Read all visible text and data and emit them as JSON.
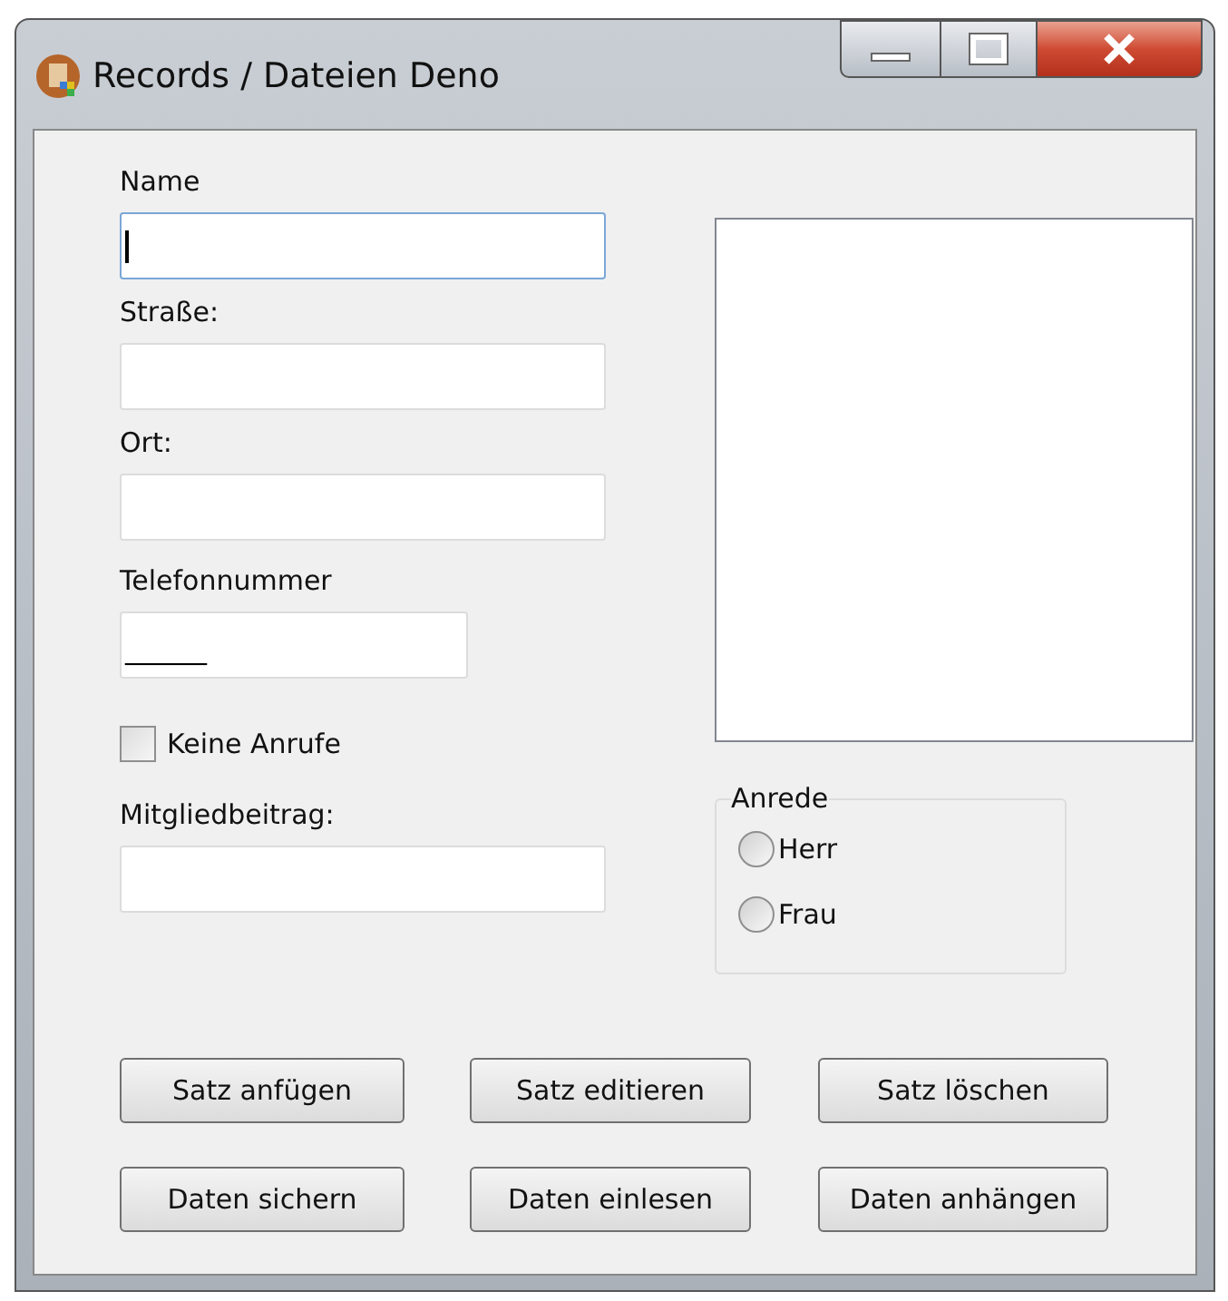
{
  "window": {
    "title": "Records / Dateien Deno"
  },
  "fields": [
    {
      "label": "Name",
      "focused": true,
      "kind": "wide"
    },
    {
      "label": "Straße:",
      "focused": false,
      "kind": "wide"
    },
    {
      "label": "Ort:",
      "focused": false,
      "kind": "wide"
    },
    {
      "label": "Telefonnummer",
      "value": "______",
      "focused": false,
      "kind": "narrow"
    }
  ],
  "checkbox": {
    "label": "Keine Anrufe",
    "checked": false
  },
  "fee_field": {
    "label": "Mitgliedbeitrag:"
  },
  "anrede": {
    "title": "Anrede",
    "options": [
      {
        "label": "Herr",
        "selected": false
      },
      {
        "label": "Frau",
        "selected": false
      }
    ]
  },
  "buttons": [
    [
      "Satz anfügen",
      "Satz editieren",
      "Satz löschen"
    ],
    [
      "Daten sichern",
      "Daten einlesen",
      "Daten anhängen"
    ]
  ]
}
